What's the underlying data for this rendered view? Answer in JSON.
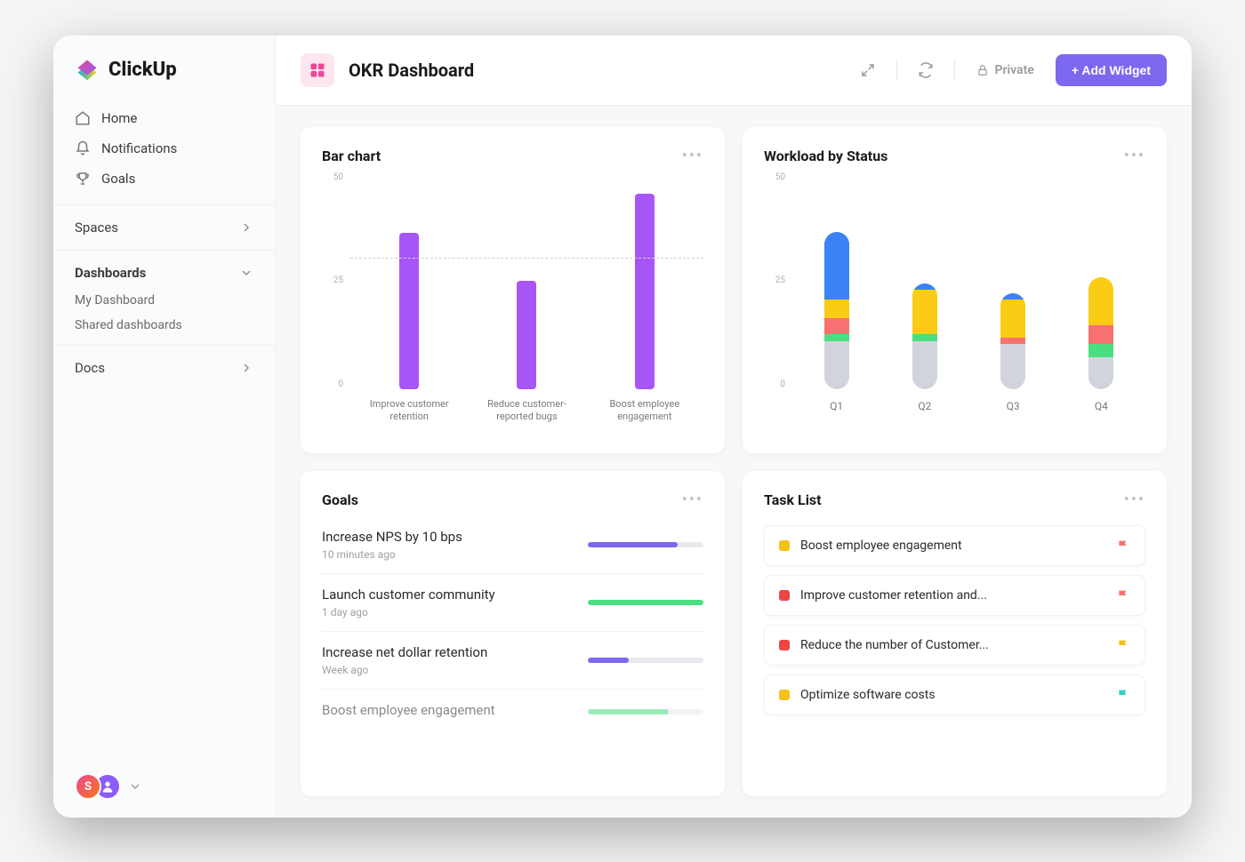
{
  "logo": {
    "text": "ClickUp"
  },
  "nav": [
    {
      "label": "Home"
    },
    {
      "label": "Notifications"
    },
    {
      "label": "Goals"
    }
  ],
  "sections": {
    "spaces": {
      "label": "Spaces"
    },
    "dashboards": {
      "label": "Dashboards",
      "items": [
        "My Dashboard",
        "Shared dashboards"
      ]
    },
    "docs": {
      "label": "Docs"
    }
  },
  "header": {
    "title": "OKR Dashboard",
    "privacy": "Private",
    "add_widget": "+ Add Widget"
  },
  "avatars": {
    "a1": "S"
  },
  "cards": {
    "bar": {
      "title": "Bar chart"
    },
    "workload": {
      "title": "Workload by Status"
    },
    "goals": {
      "title": "Goals"
    },
    "tasks": {
      "title": "Task List"
    }
  },
  "goals_list": [
    {
      "label": "Increase NPS by 10 bps",
      "time": "10 minutes ago",
      "pct": 78,
      "color": "#7b68ee"
    },
    {
      "label": "Launch customer community",
      "time": "1 day ago",
      "pct": 100,
      "color": "#4ade80"
    },
    {
      "label": "Increase net dollar retention",
      "time": "Week ago",
      "pct": 35,
      "color": "#7b68ee"
    },
    {
      "label": "Boost employee engagement",
      "time": "",
      "pct": 70,
      "color": "#4ade80"
    }
  ],
  "tasks_list": [
    {
      "label": "Boost employee engagement",
      "dot": "#f5c116",
      "flag": "#f87171"
    },
    {
      "label": "Improve customer retention and...",
      "dot": "#ef4444",
      "flag": "#f87171"
    },
    {
      "label": "Reduce the number of Customer...",
      "dot": "#ef4444",
      "flag": "#f5c116"
    },
    {
      "label": "Optimize software costs",
      "dot": "#f5c116",
      "flag": "#2dd4bf"
    }
  ],
  "chart_data": [
    {
      "card": "bar",
      "type": "bar",
      "title": "Bar chart",
      "categories": [
        "Improve customer retention",
        "Reduce customer-reported bugs",
        "Boost employee engagement"
      ],
      "values": [
        36,
        25,
        45
      ],
      "ylim": [
        0,
        50
      ],
      "yticks": [
        0,
        25,
        50
      ],
      "ref_line": 30,
      "bar_color": "#a855f7"
    },
    {
      "card": "workload",
      "type": "stacked-bar",
      "title": "Workload by Status",
      "categories": [
        "Q1",
        "Q2",
        "Q3",
        "Q4"
      ],
      "ylim": [
        0,
        50
      ],
      "yticks": [
        0,
        25,
        50
      ],
      "series": [
        {
          "name": "grey",
          "color": "#d1d5db",
          "values": [
            15,
            15,
            14,
            10
          ]
        },
        {
          "name": "green",
          "color": "#4ade80",
          "values": [
            2,
            2,
            0,
            4
          ]
        },
        {
          "name": "pink",
          "color": "#f87171",
          "values": [
            5,
            0,
            2,
            6
          ]
        },
        {
          "name": "yellow",
          "color": "#facc15",
          "values": [
            6,
            14,
            12,
            15
          ]
        },
        {
          "name": "blue",
          "color": "#3b82f6",
          "values": [
            21,
            2,
            2,
            0
          ]
        }
      ]
    }
  ]
}
